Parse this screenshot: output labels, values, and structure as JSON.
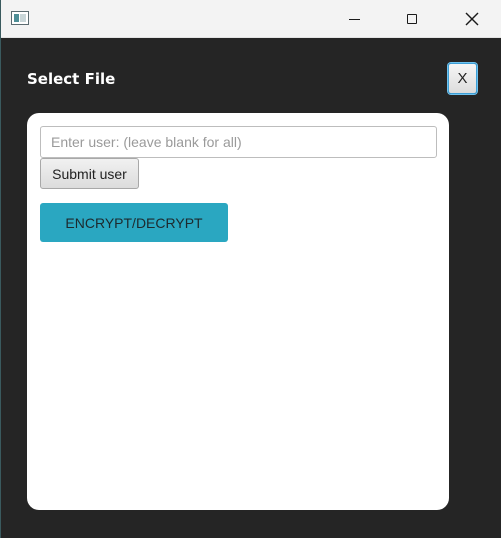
{
  "window": {
    "controls": {
      "minimize_icon": "minimize-icon",
      "maximize_icon": "maximize-icon",
      "close_icon": "close-icon"
    }
  },
  "dialog": {
    "title": "Select File",
    "close_label": "X"
  },
  "form": {
    "user_input": {
      "value": "",
      "placeholder": "Enter user: (leave blank for all)"
    },
    "submit_label": "Submit user",
    "encrypt_label": "ENCRYPT/DECRYPT"
  },
  "colors": {
    "background": "#252525",
    "panel": "#ffffff",
    "accent": "#2aa7c1"
  }
}
